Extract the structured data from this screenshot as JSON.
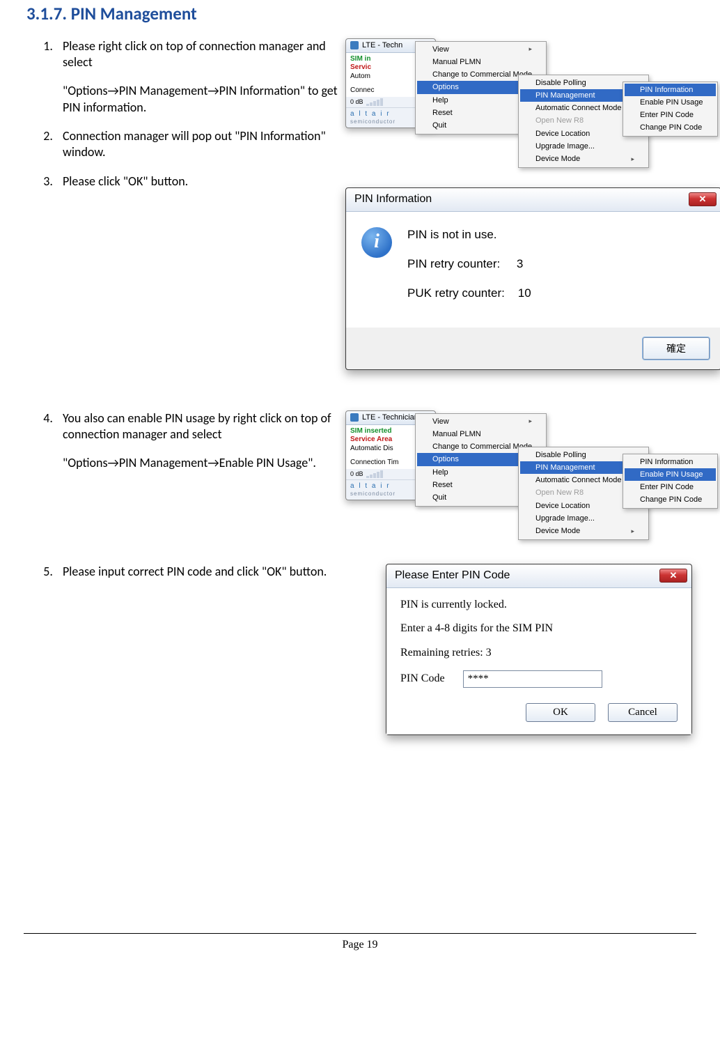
{
  "section_number": "3.1.7.",
  "section_title": "PIN Management",
  "steps": [
    {
      "line1": "Please right click on top of connection manager and select",
      "line2": "\"Options→PIN Management→PIN Information\" to get PIN information."
    },
    {
      "line1": "Connection manager will pop out \"PIN Information\" window."
    },
    {
      "line1": "Please click \"OK\" button."
    },
    {
      "line1": "You also can enable PIN usage by right click on top of connection manager and select",
      "line2": "\"Options→PIN Management→Enable PIN Usage\"."
    },
    {
      "line1": "Please input correct PIN code and click \"OK\" button."
    }
  ],
  "fig1": {
    "app_title": "LTE - Techn",
    "status": {
      "l1": "SIM in",
      "l2": "Servic",
      "l3": "Autom"
    },
    "connect_label": "Connec",
    "db_label": "0 dB",
    "logo_main": "a l t a i r",
    "logo_sub": "semiconductor",
    "menu1": [
      "View",
      "Manual PLMN",
      "Change to Commercial Mode",
      "Options",
      "Help",
      "Reset",
      "Quit"
    ],
    "menu1_highlight": "Options",
    "menu1_sub": [
      "View",
      "Options",
      "Help"
    ],
    "menu2": [
      "Disable Polling",
      "PIN Management",
      "Automatic Connect Mode",
      "Open New R8",
      "Device Location",
      "Upgrade Image...",
      "Device Mode"
    ],
    "menu2_highlight": "PIN Management",
    "menu2_disabled": [
      "Open New R8"
    ],
    "menu2_sub": [
      "PIN Management",
      "Automatic Connect Mode",
      "Device Location",
      "Device Mode"
    ],
    "menu3": [
      "PIN Information",
      "Enable PIN Usage",
      "Enter PIN Code",
      "Change PIN Code"
    ],
    "menu3_highlight": "PIN Information"
  },
  "fig2": {
    "title": "PIN Information",
    "line1": "PIN is not in use.",
    "line2a": "PIN retry counter:",
    "line2b": "3",
    "line3a": "PUK retry counter:",
    "line3b": "10",
    "ok": "確定"
  },
  "fig3": {
    "app_title": "LTE - Technician P",
    "status": {
      "l1": "SIM inserted",
      "l2": "Service Area",
      "l3": "Automatic Dis"
    },
    "connect_label": "Connection Tim",
    "db_label": "0 dB",
    "menu1": [
      "View",
      "Manual PLMN",
      "Change to Commercial Mode",
      "Options",
      "Help",
      "Reset",
      "Quit"
    ],
    "menu1_highlight": "Options",
    "menu1_sub": [
      "View",
      "Options",
      "Help"
    ],
    "menu2": [
      "Disable Polling",
      "PIN Management",
      "Automatic Connect Mode",
      "Open New R8",
      "Device Location",
      "Upgrade Image...",
      "Device Mode"
    ],
    "menu2_highlight": "PIN Management",
    "menu2_disabled": [
      "Open New R8"
    ],
    "menu2_sub": [
      "PIN Management",
      "Automatic Connect Mode",
      "Device Location",
      "Device Mode"
    ],
    "menu3": [
      "PIN Information",
      "Enable PIN Usage",
      "Enter PIN Code",
      "Change PIN Code"
    ],
    "menu3_highlight": "Enable PIN Usage"
  },
  "fig4": {
    "title": "Please Enter PIN Code",
    "l1": "PIN is currently locked.",
    "l2": "Enter a 4-8 digits for the SIM PIN",
    "l3": "Remaining retries: 3",
    "label": "PIN Code",
    "value": "****",
    "ok": "OK",
    "cancel": "Cancel"
  },
  "footer": "Page 19"
}
